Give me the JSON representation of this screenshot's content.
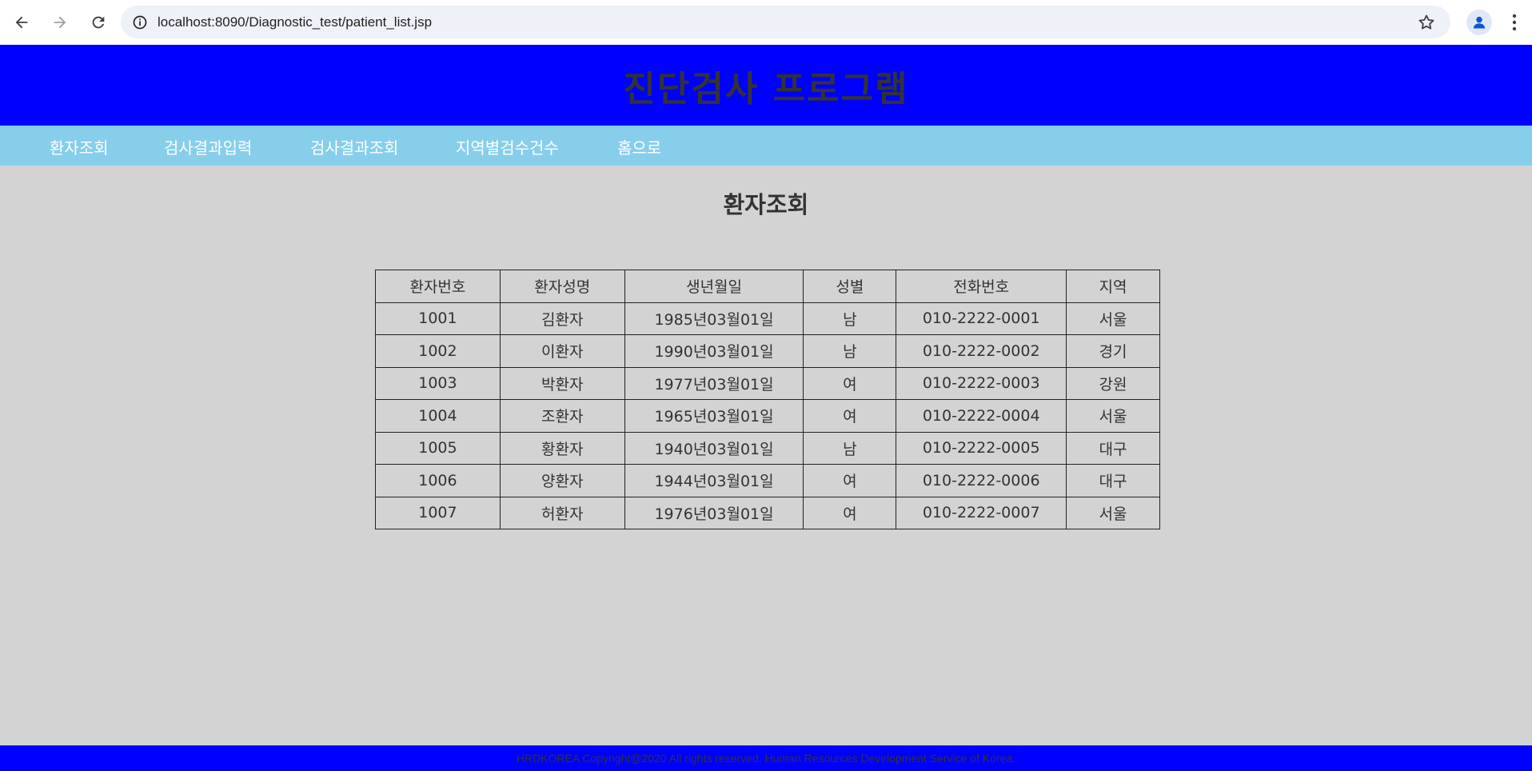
{
  "browser": {
    "url": "localhost:8090/Diagnostic_test/patient_list.jsp"
  },
  "header": {
    "title": "진단검사 프로그램"
  },
  "menu": {
    "items": [
      "환자조회",
      "검사결과입력",
      "검사결과조회",
      "지역별검수건수",
      "홈으로"
    ]
  },
  "main": {
    "title": "환자조회",
    "table": {
      "columns": [
        "환자번호",
        "환자성명",
        "생년월일",
        "성별",
        "전화번호",
        "지역"
      ],
      "rows": [
        [
          "1001",
          "김환자",
          "1985년03월01일",
          "남",
          "010-2222-0001",
          "서울"
        ],
        [
          "1002",
          "이환자",
          "1990년03월01일",
          "남",
          "010-2222-0002",
          "경기"
        ],
        [
          "1003",
          "박환자",
          "1977년03월01일",
          "여",
          "010-2222-0003",
          "강원"
        ],
        [
          "1004",
          "조환자",
          "1965년03월01일",
          "여",
          "010-2222-0004",
          "서울"
        ],
        [
          "1005",
          "황환자",
          "1940년03월01일",
          "남",
          "010-2222-0005",
          "대구"
        ],
        [
          "1006",
          "양환자",
          "1944년03월01일",
          "여",
          "010-2222-0006",
          "대구"
        ],
        [
          "1007",
          "허환자",
          "1976년03월01일",
          "여",
          "010-2222-0007",
          "서울"
        ]
      ]
    }
  },
  "footer": {
    "text": "HRDKOREA Copyright@2020 All rights reserved. Human Resources Development Service of Korea."
  },
  "colors": {
    "header_bg": "#0000ff",
    "menu_bg": "#87ceeb",
    "page_bg": "#d3d3d3"
  }
}
